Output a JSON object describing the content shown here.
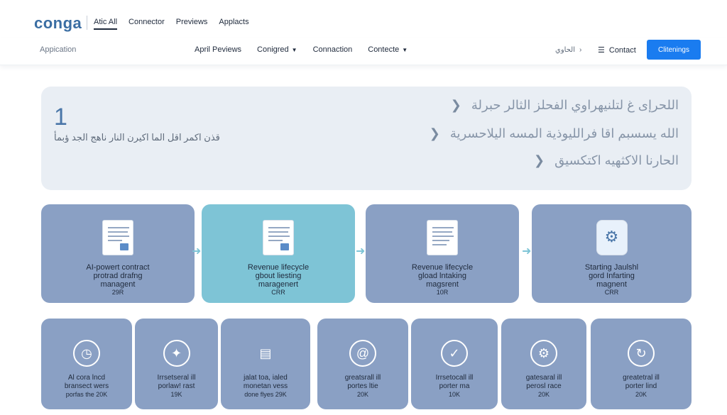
{
  "header": {
    "logo": "conga",
    "nav": [
      "Atic All",
      "Connector",
      "Previews",
      "Applacts"
    ]
  },
  "subheader": {
    "app_label": "Appication",
    "nav": [
      {
        "label": "April Peviews",
        "caret": false
      },
      {
        "label": "Conigred",
        "caret": true
      },
      {
        "label": "Connaction",
        "caret": false
      },
      {
        "label": "Contecte",
        "caret": true
      }
    ],
    "language": "الحاوي",
    "contact": "Contact",
    "cta": "Clitenings"
  },
  "panel": {
    "number": "1",
    "subtitle": "قذن اكمر اقل الما اكيرن النار ناهج الجد ؤبمأ",
    "rows": [
      "اللحرإى غ لتلنيهراوي الفحلز الثالر حبرلة",
      "الله يسسبم اقا فرالليوذية المسه اليلاحسرية",
      "الحارنا الاكثهيه اكتكسيق"
    ]
  },
  "process_cards": [
    {
      "l1": "AI-powert contract",
      "l2": "protrad drafng",
      "l3": "managent",
      "l4": "29R",
      "highlight": false
    },
    {
      "l1": "Revenue lifecycle",
      "l2": "gbout liesting",
      "l3": "maragenert",
      "l4": "CRR",
      "highlight": true
    },
    {
      "l1": "Revenue lifecycle",
      "l2": "gload lntaking",
      "l3": "magsrent",
      "l4": "10R",
      "highlight": false
    },
    {
      "l1": "Starting Jaulshl",
      "l2": "gord Infarting",
      "l3": "magnent",
      "l4": "CRR",
      "highlight": false
    }
  ],
  "service_cards": [
    {
      "icon": "clock-icon",
      "glyph": "◷",
      "l1": "Al cora lncd",
      "l2": "bransect wers",
      "l3": "porfas the  20K"
    },
    {
      "icon": "sparkle-icon",
      "glyph": "✦",
      "l1": "Irrsetseral ill",
      "l2": "porlaw! rast",
      "l3": "19K"
    },
    {
      "icon": "document-icon",
      "glyph": "▤",
      "l1": "jalat toa, ialed",
      "l2": "monetan vess",
      "l3": "done flyes  29K"
    },
    {
      "icon": "at-icon",
      "glyph": "@",
      "l1": "greatsrall ill",
      "l2": "portes ltie",
      "l3": "20K"
    },
    {
      "icon": "check-icon",
      "glyph": "✓",
      "l1": "Irrsetocall ill",
      "l2": "porter ma",
      "l3": "10K"
    },
    {
      "icon": "gear-icon",
      "glyph": "⚙",
      "l1": "gatesaral ill",
      "l2": "perosl race",
      "l3": "20K"
    },
    {
      "icon": "refresh-icon",
      "glyph": "↻",
      "l1": "greatetral ill",
      "l2": "porter lind",
      "l3": "20K"
    }
  ],
  "colors": {
    "brand": "#3b6ea3",
    "cta": "#1a7cf0",
    "card": "#8aa0c4",
    "card_highlight": "#7ec4d6",
    "panel": "#e9eef4"
  }
}
